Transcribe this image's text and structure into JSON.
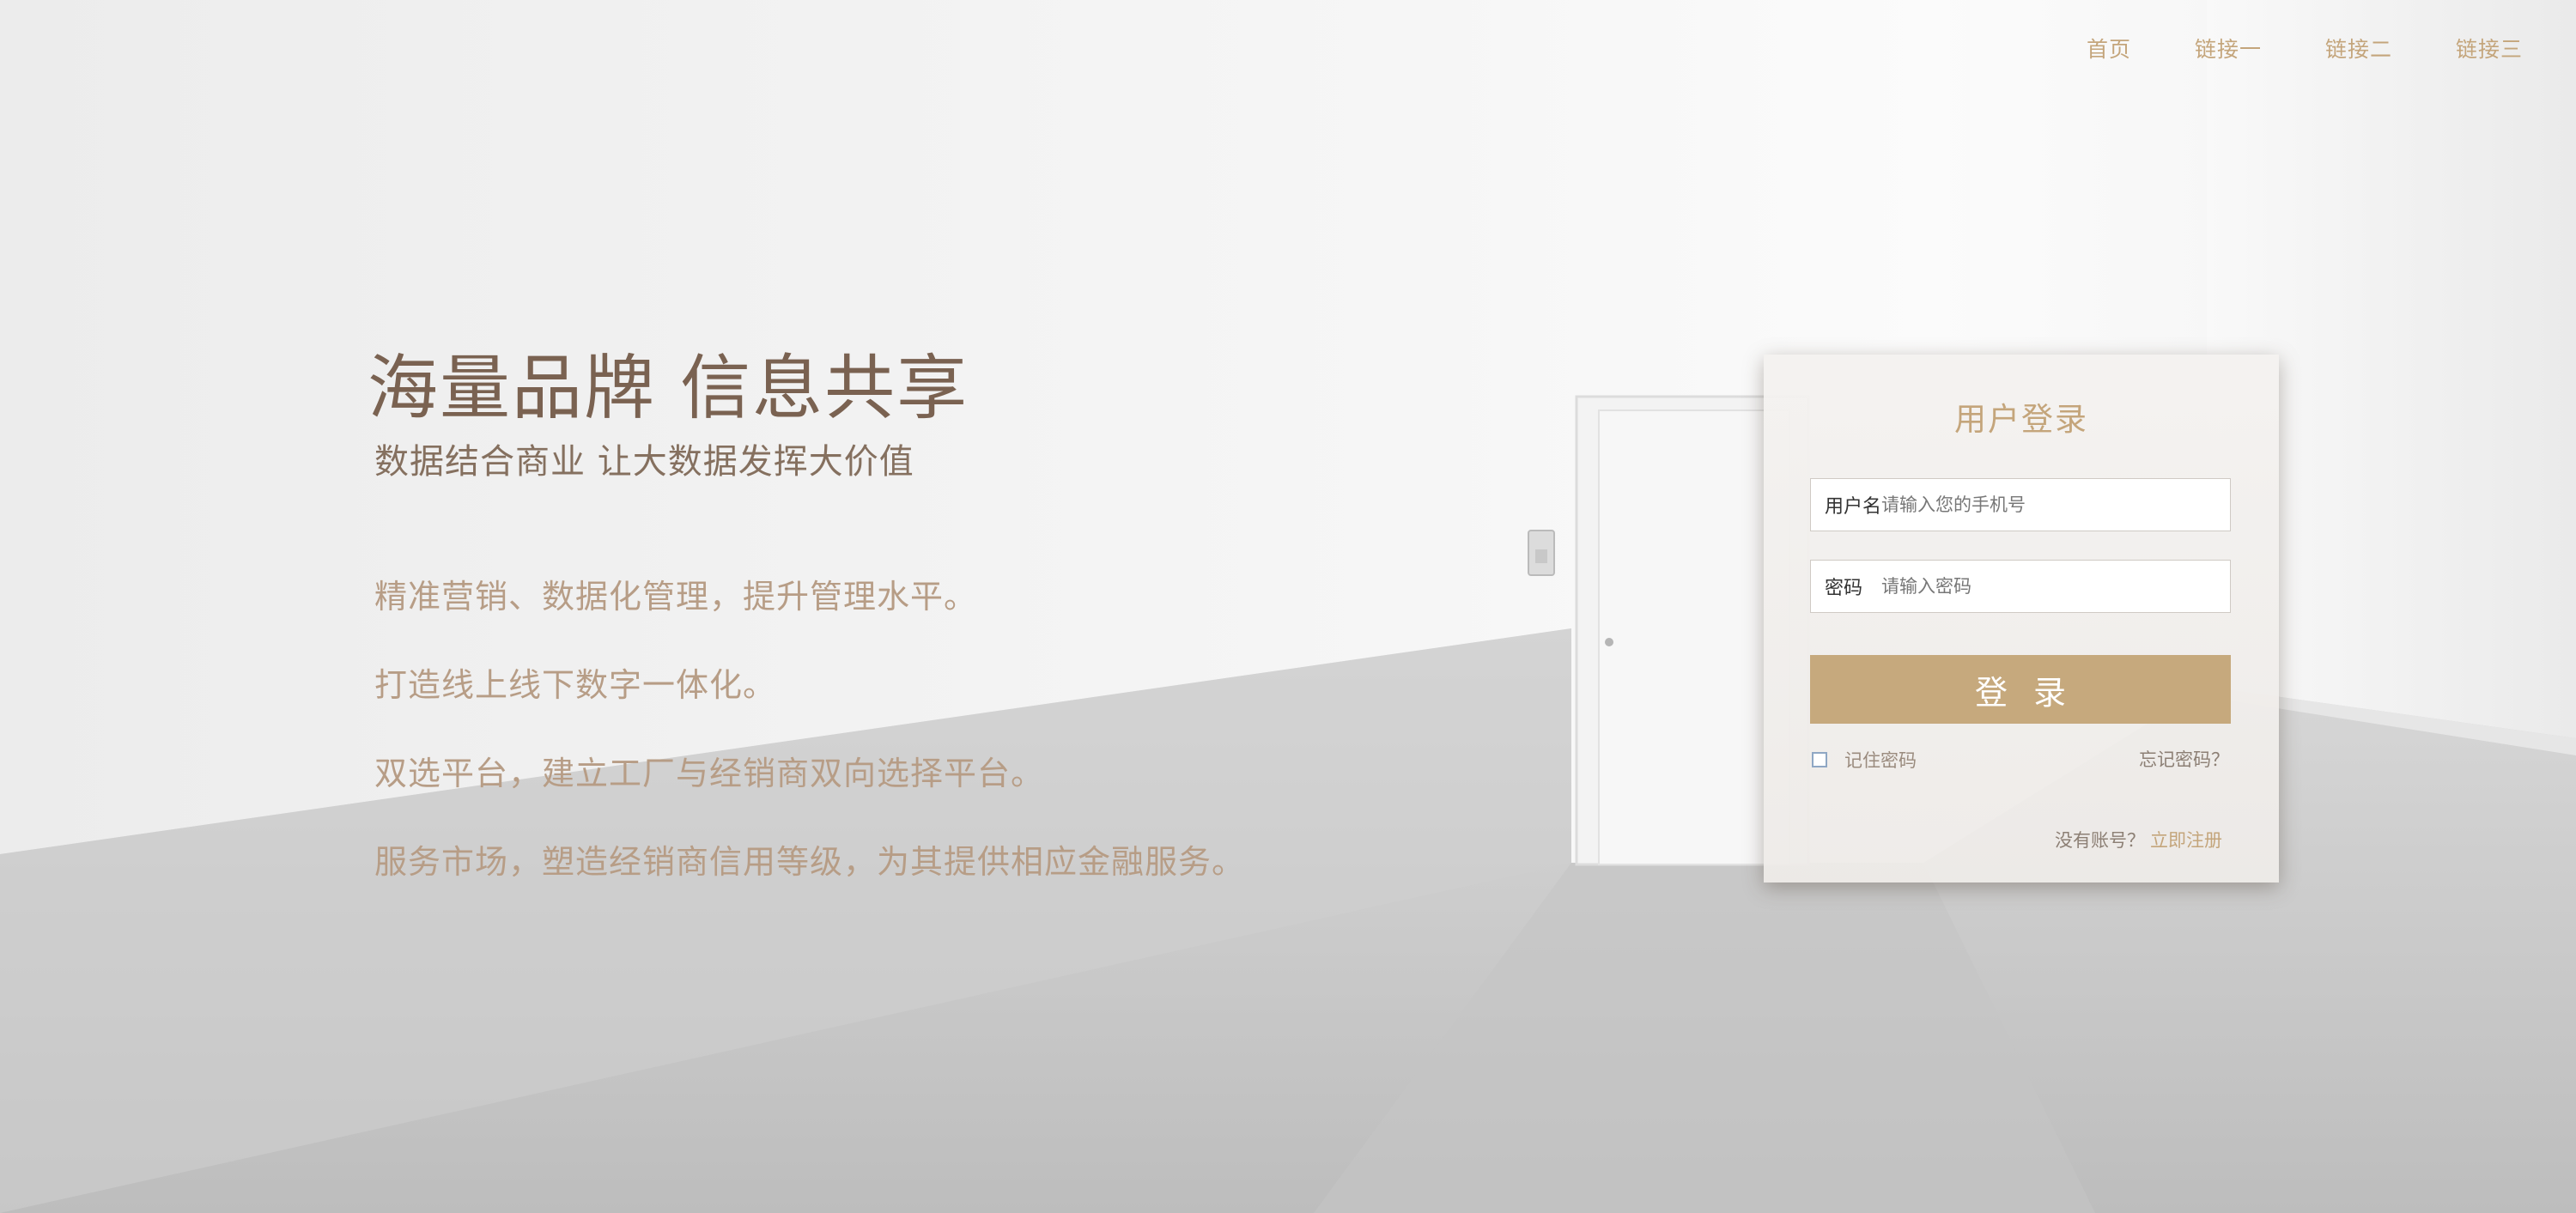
{
  "nav": {
    "items": [
      {
        "label": "首页"
      },
      {
        "label": "链接一"
      },
      {
        "label": "链接二"
      },
      {
        "label": "链接三"
      }
    ]
  },
  "hero": {
    "title": "海量品牌 信息共享",
    "subtitle": "数据结合商业 让大数据发挥大价值",
    "features": [
      "精准营销、数据化管理，提升管理水平。",
      "打造线上线下数字一体化。",
      "双选平台，建立工厂与经销商双向选择平台。",
      "服务市场，塑造经销商信用等级，为其提供相应金融服务。"
    ]
  },
  "login": {
    "title": "用户登录",
    "username_label": "用户名",
    "username_placeholder": "请输入您的手机号",
    "password_label": "密码",
    "password_placeholder": "请输入密码",
    "submit_label": "登录",
    "remember_label": "记住密码",
    "remember_checked": false,
    "forgot_label": "忘记密码？",
    "no_account_label": "没有账号？",
    "register_label": "立即注册"
  },
  "colors": {
    "accent": "#c4a57b",
    "button": "#c6a97d",
    "title_text": "#7a6251",
    "feature_text": "#b79d86"
  }
}
